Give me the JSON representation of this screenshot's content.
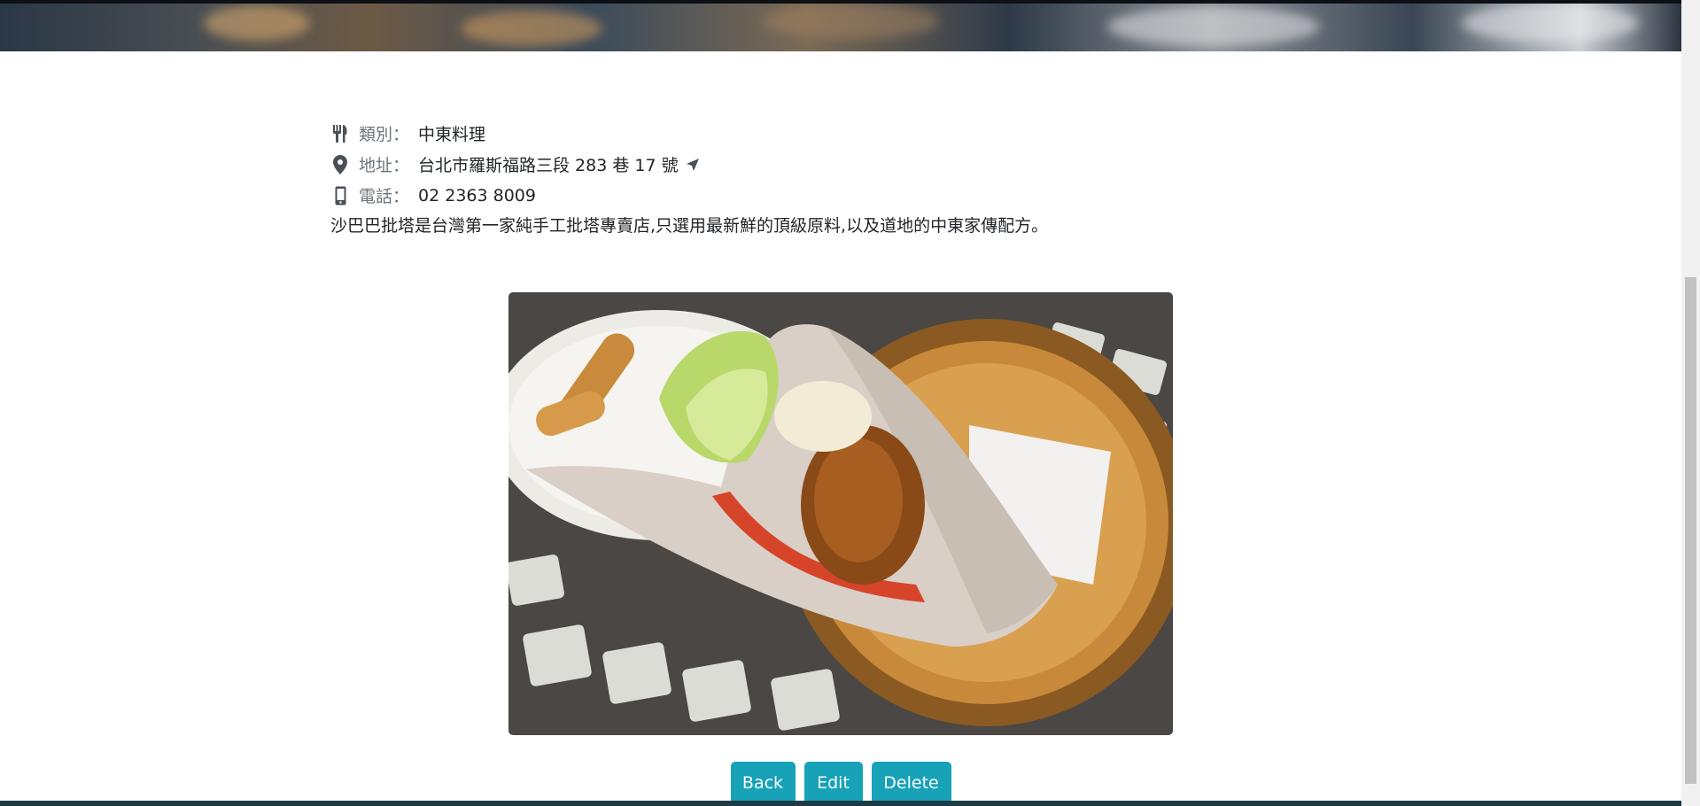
{
  "details": {
    "category_label": "類別：",
    "category_value": "中東料理",
    "address_label": "地址：",
    "address_value": "台北市羅斯福路三段 283 巷 17 號",
    "phone_label": "電話：",
    "phone_value": "02 2363 8009",
    "description": "沙巴巴批塔是台灣第一家純手工批塔專賣店,只選用最新鮮的頂級原料,以及道地的中東家傳配方。"
  },
  "icons": {
    "category": "utensils-icon",
    "address": "map-marker-icon",
    "phone": "mobile-phone-icon",
    "navigate": "location-arrow-icon"
  },
  "buttons": {
    "back": "Back",
    "edit": "Edit",
    "delete": "Delete"
  },
  "colors": {
    "button": "#17a2b8",
    "label": "#6c757d",
    "text": "#212529"
  }
}
